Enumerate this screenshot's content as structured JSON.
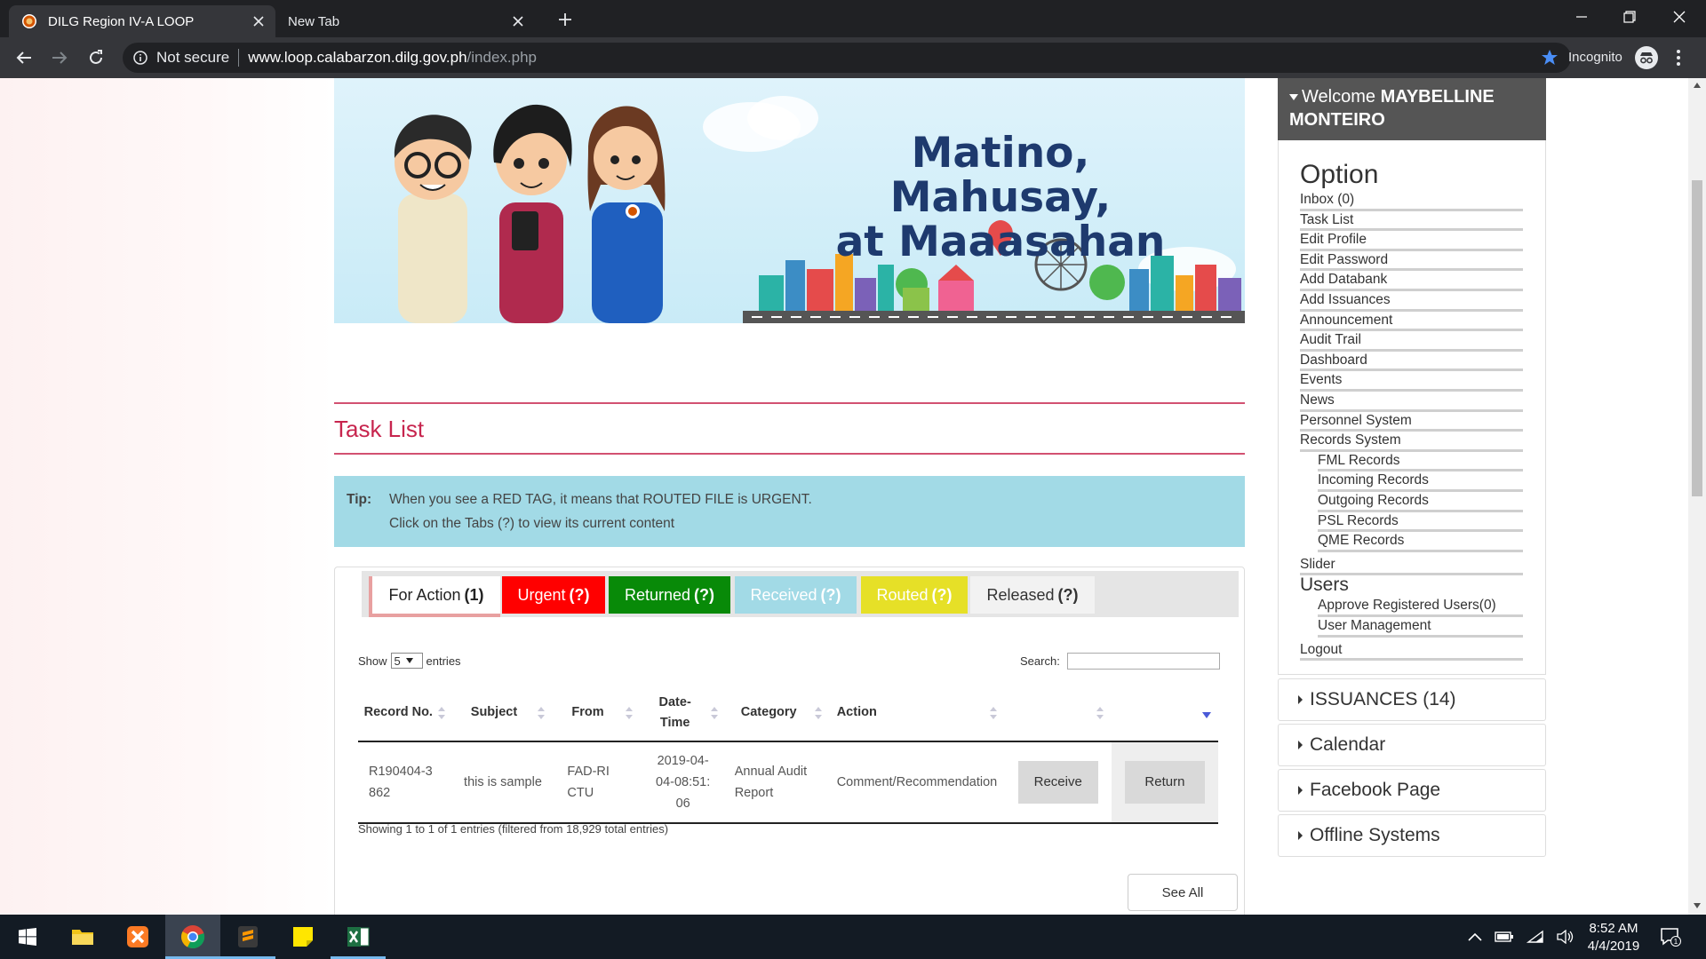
{
  "browser": {
    "tabs": [
      {
        "title": "DILG Region IV-A LOOP",
        "active": true
      },
      {
        "title": "New Tab",
        "active": false
      }
    ],
    "security": "Not secure",
    "url_host": "www.loop.calabarzon.dilg.gov.ph",
    "url_path": "/index.php",
    "mode_label": "Incognito"
  },
  "banner": {
    "line1": "Matino, Mahusay,",
    "line2": "at Maaasahan"
  },
  "main": {
    "title": "Task List",
    "tip": {
      "label": "Tip:",
      "line1": "When you see a RED TAG, it means that ROUTED FILE is URGENT.",
      "line2": "Click on the Tabs (?) to view its current content"
    },
    "tabs": [
      {
        "label": "For Action",
        "count": "(1)"
      },
      {
        "label": "Urgent",
        "count": "(?)"
      },
      {
        "label": "Returned",
        "count": "(?)"
      },
      {
        "label": "Received",
        "count": "(?)"
      },
      {
        "label": "Routed",
        "count": "(?)"
      },
      {
        "label": "Released",
        "count": "(?)"
      }
    ],
    "show_label": "Show",
    "entries_value": "5",
    "entries_label": "entries",
    "search_label": "Search:",
    "columns": [
      "Record No.",
      "Subject",
      "From",
      "Date-Time",
      "Category",
      "Action"
    ],
    "rows": [
      {
        "record_no": "R190404-3862",
        "subject": "this is sample",
        "from": "FAD-RICTU",
        "date_time": "2019-04-04-08:51:06",
        "category": "Annual Audit Report",
        "action": "Comment/Recommendation",
        "receive_label": "Receive",
        "return_label": "Return"
      }
    ],
    "info": "Showing 1 to 1 of 1 entries (filtered from 18,929 total entries)",
    "see_all_label": "See All"
  },
  "sidebar": {
    "welcome_prefix": "Welcome",
    "user_name": "MAYBELLINE MONTEIRO",
    "option_title": "Option",
    "items": [
      "Inbox (0)",
      "Task List",
      "Edit Profile",
      "Edit Password",
      "Add Databank",
      "Add Issuances",
      "Announcement",
      "Audit Trail",
      "Dashboard",
      "Events",
      "News",
      "Personnel System",
      "Records System"
    ],
    "records_sub": [
      "FML Records",
      "Incoming Records",
      "Outgoing Records",
      "PSL Records",
      "QME Records"
    ],
    "slider": "Slider",
    "users": "Users",
    "users_sub": [
      "Approve Registered Users(0)",
      "User Management"
    ],
    "logout": "Logout",
    "panels": [
      "ISSUANCES (14)",
      "Calendar",
      "Facebook Page",
      "Offline Systems"
    ]
  },
  "taskbar": {
    "time": "8:52 AM",
    "date": "4/4/2019",
    "notification_count": "1"
  },
  "colors": {
    "accent": "#c7254e",
    "urgent": "#ff0000",
    "returned": "#088a08",
    "received": "#a2dae6",
    "routed": "#e6e027",
    "tip_bg": "#a2dae6"
  }
}
